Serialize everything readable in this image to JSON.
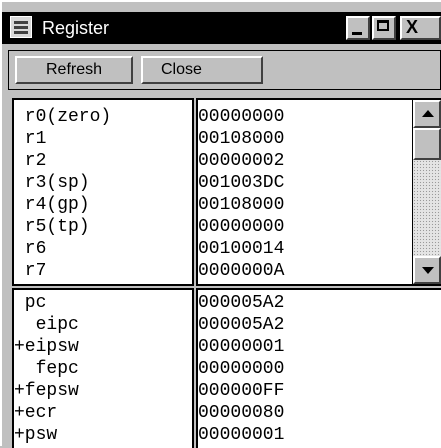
{
  "window": {
    "title": "Register"
  },
  "titlebar_buttons": {
    "minimize": "_",
    "close": "X"
  },
  "toolbar": {
    "refresh_label": "Refresh",
    "close_label": "Close"
  },
  "general_registers": [
    {
      "name": " r0(zero)",
      "value": "00000000"
    },
    {
      "name": " r1",
      "value": "00108000"
    },
    {
      "name": " r2",
      "value": "00000002"
    },
    {
      "name": " r3(sp)",
      "value": "001003DC"
    },
    {
      "name": " r4(gp)",
      "value": "00108000"
    },
    {
      "name": " r5(tp)",
      "value": "00000000"
    },
    {
      "name": " r6",
      "value": "00100014"
    },
    {
      "name": " r7",
      "value": "0000000A"
    }
  ],
  "system_registers": [
    {
      "name": " pc",
      "value": "000005A2"
    },
    {
      "name": "  eipc",
      "value": "000005A2"
    },
    {
      "name": "+eipsw",
      "value": "00000001"
    },
    {
      "name": "  fepc",
      "value": "00000000"
    },
    {
      "name": "+fepsw",
      "value": "000000FF"
    },
    {
      "name": "+ecr",
      "value": "00000080"
    },
    {
      "name": "+psw",
      "value": "00000001"
    }
  ]
}
